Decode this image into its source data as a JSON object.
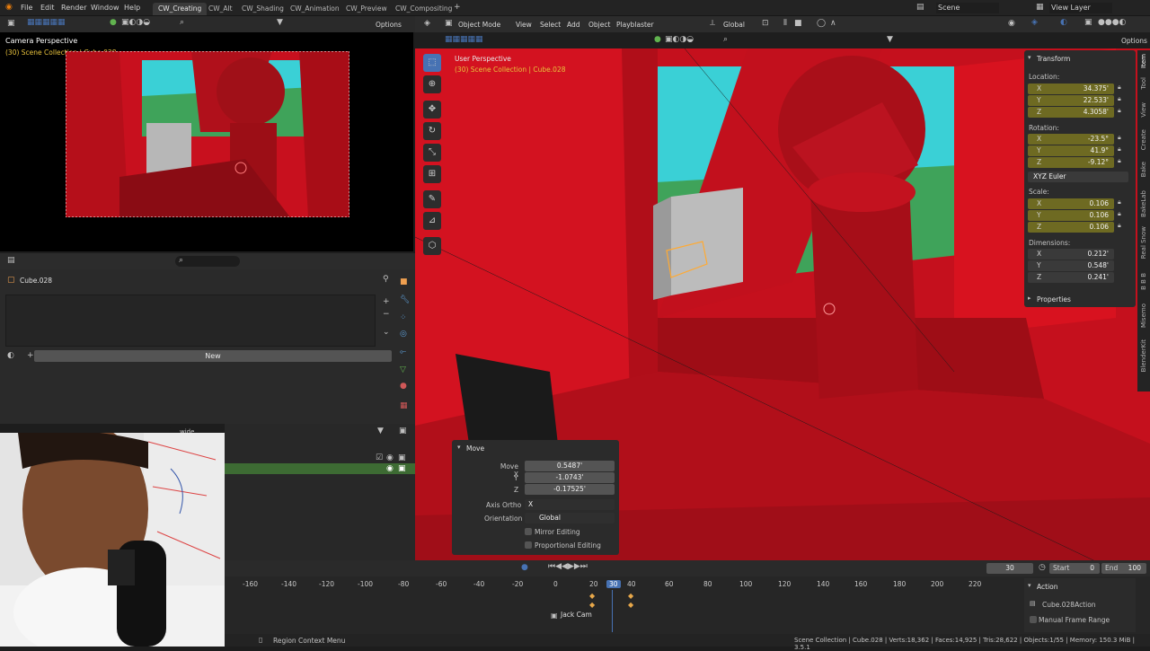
{
  "menu": {
    "file": "File",
    "edit": "Edit",
    "render": "Render",
    "window": "Window",
    "help": "Help"
  },
  "workspaces": [
    "CW_Creating",
    "CW_Alt",
    "CW_Shading",
    "CW_Animation",
    "CW_Preview",
    "CW_Compositing"
  ],
  "scene_name": "Scene",
  "view_layer": "View Layer",
  "camera_view": {
    "title": "Camera Perspective",
    "subtitle": "(30) Scene Collection | Cube.028",
    "options": "Options"
  },
  "properties_panel": {
    "object_name": "Cube.028",
    "new_label": "New"
  },
  "outliner": {
    "search_value": "wide"
  },
  "viewport_header": {
    "mode": "Object Mode",
    "view": "View",
    "select": "Select",
    "add": "Add",
    "object": "Object",
    "playblaster": "Playblaster",
    "orientation": "Global",
    "options": "Options"
  },
  "viewport": {
    "title": "User Perspective",
    "subtitle": "(30) Scene Collection | Cube.028"
  },
  "transform": {
    "header": "Transform",
    "location_label": "Location:",
    "location": {
      "x": "34.375'",
      "y": "22.533'",
      "z": "4.3058'"
    },
    "rotation_label": "Rotation:",
    "rotation": {
      "x": "-23.5°",
      "y": "41.9°",
      "z": "-9.12°"
    },
    "rotation_mode": "XYZ Euler",
    "scale_label": "Scale:",
    "scale": {
      "x": "0.106",
      "y": "0.106",
      "z": "0.106"
    },
    "dimensions_label": "Dimensions:",
    "dimensions": {
      "x": "0.212'",
      "y": "0.548'",
      "z": "0.241'"
    },
    "properties": "Properties"
  },
  "side_tabs": [
    "Item",
    "Tool",
    "View",
    "Create",
    "Bake",
    "BakeLab",
    "Real Snow",
    "B B B",
    "Misemo",
    "BlenderKit"
  ],
  "move_panel": {
    "header": "Move",
    "move_x_label": "Move X",
    "move_x": "0.5487'",
    "y_label": "Y",
    "move_y": "-1.0743'",
    "z_label": "Z",
    "move_z": "-0.17525'",
    "axis_ortho_label": "Axis Ortho",
    "axis_ortho": "X",
    "orientation_label": "Orientation",
    "orientation": "Global",
    "mirror": "Mirror Editing",
    "proportional": "Proportional Editing"
  },
  "timeline": {
    "current_frame": "30",
    "start_label": "Start",
    "start": "0",
    "end_label": "End",
    "end": "100",
    "ticks": [
      "-160",
      "-140",
      "-120",
      "-100",
      "-80",
      "-60",
      "-40",
      "-20",
      "0",
      "20",
      "30",
      "40",
      "60",
      "80",
      "100",
      "120",
      "140",
      "160",
      "180",
      "200",
      "220"
    ],
    "marker": "Jack Cam",
    "action_header": "Action",
    "action_name": "Cube.028Action",
    "manual_range": "Manual Frame Range"
  },
  "status_bar": {
    "hint": "Region Context Menu",
    "stats": "Scene Collection | Cube.028 | Verts:18,362 | Faces:14,925 | Tris:28,622 | Objects:1/55 | Memory: 150.3 MiB | 3.5.1"
  },
  "colors": {
    "accent": "#4772b3",
    "scene_red": "#c8101e",
    "selection_yellow": "#ffaa33",
    "sky": "#3ad0d6",
    "ground": "#3fa35a"
  }
}
